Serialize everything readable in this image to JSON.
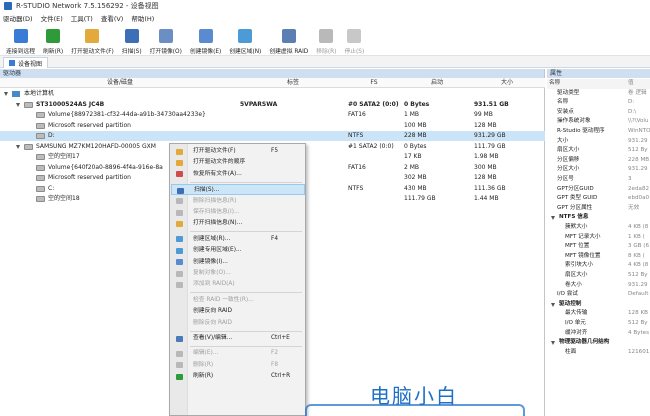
{
  "window": {
    "title": "R-STUDIO Network 7.5.156292 - 设备视图"
  },
  "menu": [
    "驱动器(D)",
    "文件(E)",
    "工具(T)",
    "查看(V)",
    "帮助(H)"
  ],
  "toolbar": [
    {
      "label": "连接到远程",
      "icon": "connect-icon",
      "color": "#3a7bd5",
      "disabled": false
    },
    {
      "label": "刷新(R)",
      "icon": "refresh-icon",
      "color": "#2e9a3a",
      "disabled": false
    },
    {
      "label": "打开驱动文件(F)",
      "icon": "folder-open-icon",
      "color": "#e2a93b",
      "disabled": false
    },
    {
      "label": "扫描(S)",
      "icon": "scan-icon",
      "color": "#3d6fb6",
      "disabled": false
    },
    {
      "label": "打开镜像(O)",
      "icon": "open-image-icon",
      "color": "#6b8fc4",
      "disabled": false
    },
    {
      "label": "创建镜像(E)",
      "icon": "create-image-icon",
      "color": "#5a8ad0",
      "disabled": false
    },
    {
      "label": "创建区域(N)",
      "icon": "create-region-icon",
      "color": "#4d9bd6",
      "disabled": false
    },
    {
      "label": "创建虚拟 RAID",
      "icon": "raid-icon",
      "color": "#5b7fb0",
      "disabled": false
    },
    {
      "label": "移除(R)",
      "icon": "remove-icon",
      "color": "#b9b9b9",
      "disabled": true
    },
    {
      "label": "停止(S)",
      "icon": "stop-icon",
      "color": "#c8c8c8",
      "disabled": true
    }
  ],
  "tabs": {
    "device_view": "设备视图"
  },
  "left_panel": {
    "header": "驱动器",
    "columns": {
      "device": "设备/磁盘",
      "label": "标签",
      "fs": "FS",
      "start": "启动",
      "size": "大小"
    },
    "rows": [
      {
        "indent": 0,
        "expand": true,
        "icon": "computer",
        "name": "本地计算机",
        "label": "",
        "fs": "",
        "start": "",
        "size": "",
        "bold": false,
        "selected": false
      },
      {
        "indent": 1,
        "expand": true,
        "icon": "disk",
        "name": "ST31000524AS JC4B",
        "label": "5VPARSWA",
        "fs": "#0 SATA2 (0:0)",
        "start": "0 Bytes",
        "size": "931.51 GB",
        "bold": true,
        "selected": false
      },
      {
        "indent": 2,
        "expand": false,
        "icon": "disk",
        "name": "Volume{88972381-cf32-44da-a91b-34730aa4233e}",
        "label": "",
        "fs": "FAT16",
        "start": "1 MB",
        "size": "99 MB",
        "bold": false,
        "selected": false
      },
      {
        "indent": 2,
        "expand": false,
        "icon": "disk",
        "name": "Microsoft reserved partition",
        "label": "",
        "fs": "",
        "start": "100 MB",
        "size": "128 MB",
        "bold": false,
        "selected": false
      },
      {
        "indent": 2,
        "expand": false,
        "icon": "disk",
        "name": "D:",
        "label": "",
        "fs": "NTFS",
        "start": "228 MB",
        "size": "931.29 GB",
        "bold": false,
        "selected": true
      },
      {
        "indent": 1,
        "expand": true,
        "icon": "disk",
        "name": "SAMSUNG MZ7KM120HAFD-00005 GXM",
        "label": "",
        "fs": "#1 SATA2 (0:0)",
        "start": "0 Bytes",
        "size": "111.79 GB",
        "bold": false,
        "selected": false
      },
      {
        "indent": 2,
        "expand": false,
        "icon": "disk",
        "name": "空的空间17",
        "label": "",
        "fs": "",
        "start": "17 KB",
        "size": "1.98 MB",
        "bold": false,
        "selected": false
      },
      {
        "indent": 2,
        "expand": false,
        "icon": "disk",
        "name": "Volume{640f20a0-8896-4f4a-916e-8a",
        "label": "",
        "fs": "FAT16",
        "start": "2 MB",
        "size": "300 MB",
        "bold": false,
        "selected": false
      },
      {
        "indent": 2,
        "expand": false,
        "icon": "disk",
        "name": "Microsoft reserved partition",
        "label": "",
        "fs": "",
        "start": "302 MB",
        "size": "128 MB",
        "bold": false,
        "selected": false
      },
      {
        "indent": 2,
        "expand": false,
        "icon": "disk",
        "name": "C:",
        "label": "",
        "fs": "NTFS",
        "start": "430 MB",
        "size": "111.36 GB",
        "bold": false,
        "selected": false
      },
      {
        "indent": 2,
        "expand": false,
        "icon": "disk",
        "name": "空的空间18",
        "label": "",
        "fs": "",
        "start": "111.79 GB",
        "size": "1.44 MB",
        "bold": false,
        "selected": false
      }
    ]
  },
  "context_menu": [
    {
      "label": "打开驱动文件(F)",
      "shortcut": "F5",
      "icon": "folder-open-icon",
      "color": "#e2a93b",
      "disabled": false,
      "highlight": false
    },
    {
      "label": "打开驱动文件的顺序",
      "shortcut": "",
      "icon": "folder-order-icon",
      "color": "#e2a93b",
      "disabled": false,
      "highlight": false
    },
    {
      "label": "恢复所有文件(A)...",
      "shortcut": "",
      "icon": "recover-icon",
      "color": "#d04b4b",
      "disabled": false,
      "highlight": false
    },
    {
      "sep": true
    },
    {
      "label": "扫描(S)...",
      "shortcut": "",
      "icon": "scan-icon",
      "color": "#3d6fb6",
      "disabled": false,
      "highlight": true
    },
    {
      "label": "删除扫描信息(R)",
      "shortcut": "",
      "icon": "delete-scan-icon",
      "color": "#b8b8b8",
      "disabled": true,
      "highlight": false
    },
    {
      "label": "保存扫描信息(I)...",
      "shortcut": "",
      "icon": "save-scan-icon",
      "color": "#b8b8b8",
      "disabled": true,
      "highlight": false
    },
    {
      "label": "打开扫描信息(N)...",
      "shortcut": "",
      "icon": "open-scan-icon",
      "color": "#e2a93b",
      "disabled": false,
      "highlight": false
    },
    {
      "sep": true
    },
    {
      "label": "创建区域(R)...",
      "shortcut": "F4",
      "icon": "create-region-icon",
      "color": "#4d9bd6",
      "disabled": false,
      "highlight": false
    },
    {
      "label": "创建专用区域(E)...",
      "shortcut": "",
      "icon": "special-region-icon",
      "color": "#4d9bd6",
      "disabled": false,
      "highlight": false
    },
    {
      "label": "创建镜像(I)...",
      "shortcut": "",
      "icon": "create-image-icon",
      "color": "#5a8ad0",
      "disabled": false,
      "highlight": false
    },
    {
      "label": "复制对象(O)...",
      "shortcut": "",
      "icon": "copy-object-icon",
      "color": "#b8b8b8",
      "disabled": true,
      "highlight": false
    },
    {
      "label": "添加到 RAID(A)",
      "shortcut": "",
      "icon": "add-raid-icon",
      "color": "#b8b8b8",
      "disabled": true,
      "highlight": false
    },
    {
      "sep": true
    },
    {
      "label": "检查 RAID 一致性(R)...",
      "shortcut": "",
      "icon": "",
      "color": "",
      "disabled": true,
      "highlight": false
    },
    {
      "label": "创建反向 RAID",
      "shortcut": "",
      "icon": "",
      "color": "",
      "disabled": false,
      "highlight": false
    },
    {
      "label": "删除反向 RAID",
      "shortcut": "",
      "icon": "",
      "color": "",
      "disabled": true,
      "highlight": false
    },
    {
      "sep": true
    },
    {
      "label": "查看(V)/编辑...",
      "shortcut": "Ctrl+E",
      "icon": "view-edit-icon",
      "color": "#4a7ab8",
      "disabled": false,
      "highlight": false
    },
    {
      "sep": true
    },
    {
      "label": "编辑(E)...",
      "shortcut": "F2",
      "icon": "edit-icon",
      "color": "#b8b8b8",
      "disabled": true,
      "highlight": false
    },
    {
      "label": "删除(R)",
      "shortcut": "F8",
      "icon": "delete-icon",
      "color": "#b8b8b8",
      "disabled": true,
      "highlight": false
    },
    {
      "label": "刷新(R)",
      "shortcut": "Ctrl+R",
      "icon": "refresh-icon",
      "color": "#2e9a3a",
      "disabled": false,
      "highlight": false
    }
  ],
  "properties": {
    "header": "属性",
    "rows": [
      {
        "key": "名称",
        "value": "值",
        "indent": 2,
        "section": false
      },
      {
        "key": "驱动类型",
        "value": "卷 逻辑",
        "indent": 10,
        "section": false
      },
      {
        "key": "名称",
        "value": "D:",
        "indent": 10,
        "section": false
      },
      {
        "key": "安装点",
        "value": "D:\\",
        "indent": 10,
        "section": false
      },
      {
        "key": "操作系统对象",
        "value": "\\\\?\\Volu",
        "indent": 10,
        "section": false
      },
      {
        "key": "R-Studio 驱动程序",
        "value": "WinNTO",
        "indent": 10,
        "section": false
      },
      {
        "key": "大小",
        "value": "931.29",
        "indent": 10,
        "section": false
      },
      {
        "key": "扇区大小",
        "value": "512 By",
        "indent": 10,
        "section": false
      },
      {
        "key": "分区偏移",
        "value": "228 MB",
        "indent": 10,
        "section": false
      },
      {
        "key": "分区大小",
        "value": "931.29",
        "indent": 10,
        "section": false
      },
      {
        "key": "分区号",
        "value": "3",
        "indent": 10,
        "section": false
      },
      {
        "key": "GPT分区GUID",
        "value": "2eda82",
        "indent": 10,
        "section": false
      },
      {
        "key": "GPT 类型 GUID",
        "value": "ebd0a0",
        "indent": 10,
        "section": false
      },
      {
        "key": "GPT 分区属性",
        "value": "无效",
        "indent": 10,
        "section": false
      },
      {
        "key": "NTFS 信息",
        "value": "",
        "indent": 12,
        "section": true
      },
      {
        "key": "簇默大小",
        "value": "4 KB (8",
        "indent": 18,
        "section": false
      },
      {
        "key": "MFT 记录大小",
        "value": "1 KB (",
        "indent": 18,
        "section": false
      },
      {
        "key": "MFT 位置",
        "value": "3 GB (6",
        "indent": 18,
        "section": false
      },
      {
        "key": "MFT 镜像位置",
        "value": "8 KB (",
        "indent": 18,
        "section": false
      },
      {
        "key": "索引块大小",
        "value": "4 KB (8",
        "indent": 18,
        "section": false
      },
      {
        "key": "扇区大小",
        "value": "512 By",
        "indent": 18,
        "section": false
      },
      {
        "key": "卷大小",
        "value": "931.29",
        "indent": 18,
        "section": false
      },
      {
        "key": "I/O 尝试",
        "value": "Default",
        "indent": 10,
        "section": false
      },
      {
        "key": "驱动控制",
        "value": "",
        "indent": 12,
        "section": true
      },
      {
        "key": "最大传输",
        "value": "128 KB",
        "indent": 18,
        "section": false
      },
      {
        "key": "I/O 单元",
        "value": "512 By",
        "indent": 18,
        "section": false
      },
      {
        "key": "缓冲对齐",
        "value": "4 Bytes",
        "indent": 18,
        "section": false
      },
      {
        "key": "物理驱动器几何结构",
        "value": "",
        "indent": 12,
        "section": true
      },
      {
        "key": "柱面",
        "value": "121601",
        "indent": 18,
        "section": false
      }
    ]
  },
  "watermark": {
    "text": "电脑小白"
  }
}
